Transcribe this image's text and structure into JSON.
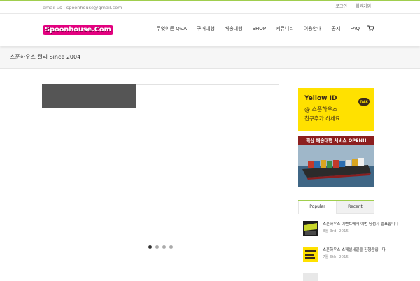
{
  "topbar": {
    "email": "email us : spoonhouse@gmail.com",
    "links": [
      "로그인",
      "회원가입"
    ]
  },
  "header": {
    "logo_text": "Spoonhouse.Com",
    "nav": [
      {
        "label": "무엇이든 Q&A"
      },
      {
        "label": "구매대행"
      },
      {
        "label": "배송대행"
      },
      {
        "label": "SHOP"
      },
      {
        "label": "커뮤니티"
      },
      {
        "label": "이용안내"
      },
      {
        "label": "공지"
      },
      {
        "label": "FAQ"
      }
    ],
    "cart_icon": "cart-icon"
  },
  "titlebar": {
    "title": "스푼하우스 캘리 Since 2004"
  },
  "slider": {
    "dots": 4,
    "active_dot": 0
  },
  "sidebar": {
    "yellow_banner": {
      "line1": "Yellow ID",
      "line2": "@ 스푼하우스",
      "line3": "친구추가 하세요.",
      "talk": "TALK"
    },
    "ship_banner": {
      "headline": "해상 배송대행 서비스  OPEN!!"
    },
    "tabs": {
      "popular": "Popular",
      "recent": "Recent"
    },
    "posts": [
      {
        "title": "스푼하우스 이벤트에서 이번 당첨자 발표합니다",
        "date": "8월 3rd, 2015"
      },
      {
        "title": "스푼하우스 스페셜세일을 진행중입니다!",
        "date": "7월 6th, 2015"
      }
    ]
  },
  "colors": {
    "accent": "#a0ce4e",
    "logo": "#e3007f",
    "yellow": "#ffe100"
  }
}
